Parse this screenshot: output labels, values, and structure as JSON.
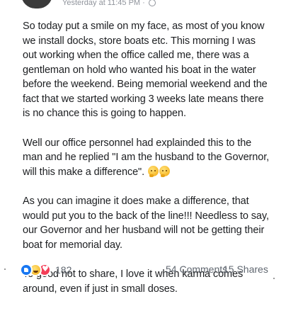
{
  "header": {
    "timestamp": "Yesterday at 11:45 PM",
    "privacy_icon": "globe-icon"
  },
  "post": {
    "paragraphs": [
      {
        "text": "So today put a smile on my face, as most of you know we install docks, store boats etc. This morning I was out working when the office called me, there was a gentleman on hold who wanted his boat in the water before the weekend. Being memorial weekend and the fact that we started working 3 weeks late means there is no chance this is going to happen."
      },
      {
        "text": "Well our office personnel had explainded this to the man and he replied \"I am the husband to the Governor, will this make a difference\".",
        "emojis": [
          "thinking-face-emoji",
          "thinking-face-emoji"
        ]
      },
      {
        "text": "As you can imagine it does make a difference, that would put you to the back of the line!!! Needless to say,  our Governor and her husband will not be getting their boat for memorial day."
      },
      {
        "text": "To good not to share, I love it when karma comes around, even if just in small doses."
      }
    ]
  },
  "footer": {
    "reactions": [
      "like-icon",
      "haha-icon",
      "love-icon"
    ],
    "reaction_count": "182",
    "comments": "54 Comments",
    "shares": "15 Shares"
  },
  "colors": {
    "text": "#1c1e21",
    "meta": "#606770",
    "like": "#1877f2",
    "love": "#f33e58",
    "haha": "#f7b92b"
  }
}
